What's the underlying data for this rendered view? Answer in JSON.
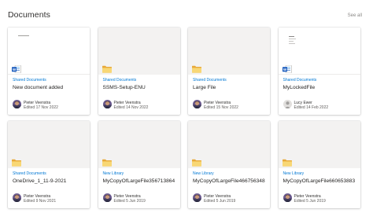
{
  "section": {
    "title": "Documents",
    "see_all": "See all"
  },
  "cards": [
    {
      "location": "Shared Documents",
      "name": "New document added",
      "author": "Pieter Veenstra",
      "edited": "Edited 17 Nov 2022",
      "icon": "word-doc-icon",
      "thumb": "doc",
      "avatar": "photo"
    },
    {
      "location": "Shared Documents",
      "name": "SSMS-Setup-ENU",
      "author": "Pieter Veenstra",
      "edited": "Edited 14 Nov 2022",
      "icon": "folder-icon",
      "thumb": "blank",
      "avatar": "photo"
    },
    {
      "location": "Shared Documents",
      "name": "Large File",
      "author": "Pieter Veenstra",
      "edited": "Edited 15 Nov 2022",
      "icon": "folder-icon",
      "thumb": "blank",
      "avatar": "photo"
    },
    {
      "location": "Shared Documents",
      "name": "MyLockedFile",
      "author": "Lucy Ewer",
      "edited": "Edited 14 Feb 2022",
      "icon": "word-doc-icon",
      "thumb": "doc",
      "avatar": "placeholder"
    },
    {
      "location": "Shared Documents",
      "name": "OneDrive_1_11-9-2021",
      "author": "Pieter Veenstra",
      "edited": "Edited 9 Nov 2021",
      "icon": "folder-icon",
      "thumb": "blank",
      "avatar": "photo"
    },
    {
      "location": "New Library",
      "name": "MyCopyOfLargeFile356713864",
      "author": "Pieter Veenstra",
      "edited": "Edited 5 Jun 2019",
      "icon": "folder-icon",
      "thumb": "blank",
      "avatar": "photo"
    },
    {
      "location": "New Library",
      "name": "MyCopyOfLargeFile466756348",
      "author": "Pieter Veenstra",
      "edited": "Edited 5 Jun 2019",
      "icon": "folder-icon",
      "thumb": "blank",
      "avatar": "photo"
    },
    {
      "location": "New Library",
      "name": "MyCopyOfLargeFile660653883",
      "author": "Pieter Veenstra",
      "edited": "Edited 5 Jun 2019",
      "icon": "folder-icon",
      "thumb": "blank",
      "avatar": "photo"
    }
  ],
  "colors": {
    "link_blue": "#0078d4",
    "folder_yellow": "#f8d775",
    "word_blue": "#185abd"
  }
}
